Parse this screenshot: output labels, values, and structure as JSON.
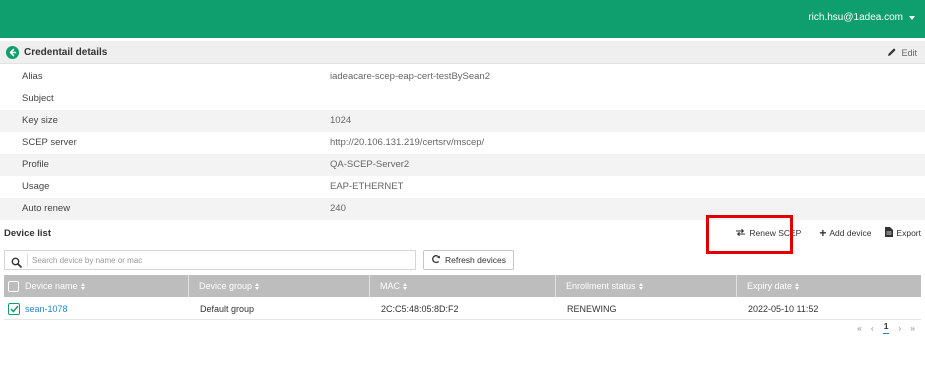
{
  "topbar": {
    "user_email": "rich.hsu@1adea.com"
  },
  "header": {
    "title": "Credentail details",
    "edit_label": "Edit"
  },
  "details": [
    {
      "label": "Alias",
      "value": "iadeacare-scep-eap-cert-testBySean2"
    },
    {
      "label": "Subject",
      "value": ""
    },
    {
      "label": "Key size",
      "value": "1024"
    },
    {
      "label": "SCEP server",
      "value": "http://20.106.131.219/certsrv/mscep/"
    },
    {
      "label": "Profile",
      "value": "QA-SCEP-Server2"
    },
    {
      "label": "Usage",
      "value": "EAP-ETHERNET"
    },
    {
      "label": "Auto renew",
      "value": "240"
    }
  ],
  "device_list": {
    "title": "Device list",
    "actions": {
      "renew_label": "Renew SCEP",
      "add_label": "Add device",
      "export_label": "Export"
    },
    "search": {
      "placeholder": "Search device by name or mac"
    },
    "refresh_label": "Refresh devices",
    "columns": [
      "Device name",
      "Device group",
      "MAC",
      "Enrollment status",
      "Expiry date"
    ],
    "rows": [
      {
        "name": "sean-1078",
        "group": "Default group",
        "mac": "2C:C5:48:05:8D:F2",
        "status": "RENEWING",
        "expiry": "2022-05-10 11:52",
        "checked": true
      }
    ],
    "pager": {
      "first": "«",
      "prev": "‹",
      "current": "1",
      "next": "›",
      "last": "»"
    }
  },
  "colors": {
    "brand": "#0f9e6e",
    "link": "#1e86c9",
    "highlight": "#e00000",
    "table_header": "#bdbdbd"
  }
}
